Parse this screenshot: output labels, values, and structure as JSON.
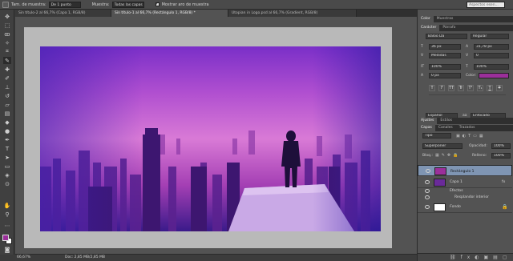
{
  "options_bar": {
    "sample_size_label": "Tam. de muestra:",
    "sample_size_value": "De 1 punto",
    "sample_label": "Muestra:",
    "sample_value": "Todas las capas",
    "show_ring_label": "Mostrar aro de muestra",
    "search_placeholder": "Aspectos esen..."
  },
  "tabs": [
    {
      "label": "Sin título-2 al 66,7% (Capa 1, RGB/8)",
      "active": false
    },
    {
      "label": "Sin título-1 al 66,7% (Rectángulo 1, RGB/8) *",
      "active": true
    },
    {
      "label": "Utopian in Logo.psd al 66,7% (Gradient, RGB/8)",
      "active": false
    }
  ],
  "status": {
    "zoom": "66,67%",
    "doc": "Doc: 2,85 MB/2,85 MB"
  },
  "color_panel": {
    "tabs": [
      "Color",
      "Muestras"
    ]
  },
  "character_panel": {
    "tabs": [
      "Carácter",
      "Párrafo"
    ],
    "font_family": "Baloo Da",
    "font_style": "Regular",
    "font_size": "36 px",
    "leading": "31,78 px",
    "kerning": "Medidas",
    "tracking": "0",
    "vscale": "100%",
    "hscale": "100%",
    "baseline": "0 px",
    "color_label": "Color:",
    "color_value": "#9b2f9a",
    "language": "Español",
    "antialias": "Enfocado",
    "aa_label": "aa",
    "style_buttons": [
      "T",
      "T",
      "TT",
      "Tr",
      "T¹",
      "T₁",
      "T",
      "T"
    ]
  },
  "adjust_panel": {
    "tabs": [
      "Ajustes",
      "Estilos"
    ]
  },
  "layers_panel": {
    "tabs": [
      "Capas",
      "Canales",
      "Trazados"
    ],
    "filter": "Tipo",
    "blend_mode": "Superponer",
    "opacity_label": "Opacidad:",
    "opacity": "100%",
    "lock_label": "Bloq.:",
    "fill_label": "Relleno:",
    "fill": "100%",
    "layers": [
      {
        "name": "Rectángulo 1",
        "selected": true
      },
      {
        "name": "Capa 1",
        "selected": false
      }
    ],
    "effects_label": "Efectos",
    "effect_item": "Resplandor interior",
    "fx_label": "fx",
    "background_layer": "Fondo"
  },
  "colors": {
    "foreground": "#9b2f9a",
    "background": "#ffffff",
    "accent_selected": "#7f95b3"
  }
}
